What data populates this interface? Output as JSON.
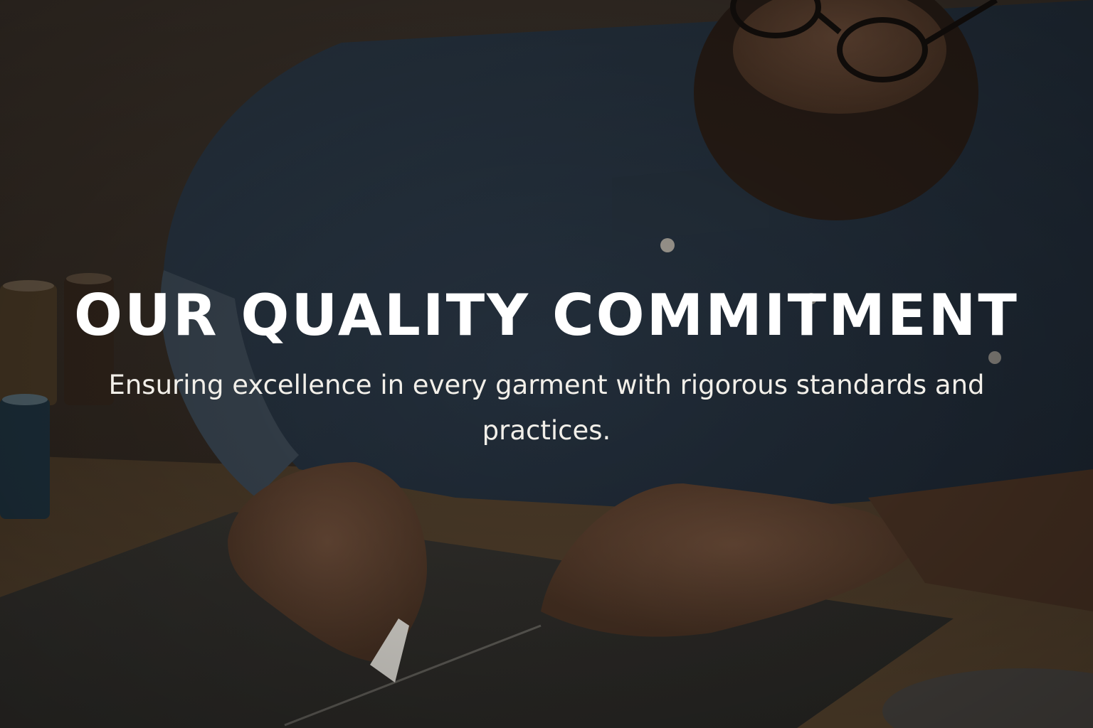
{
  "hero": {
    "title": "OUR QUALITY COMMITMENT",
    "subtitle": "Ensuring excellence in every garment with rigorous standards and practices.",
    "background_image": "tailor-marking-fabric-with-chalk",
    "overlay_color": "#000000"
  }
}
